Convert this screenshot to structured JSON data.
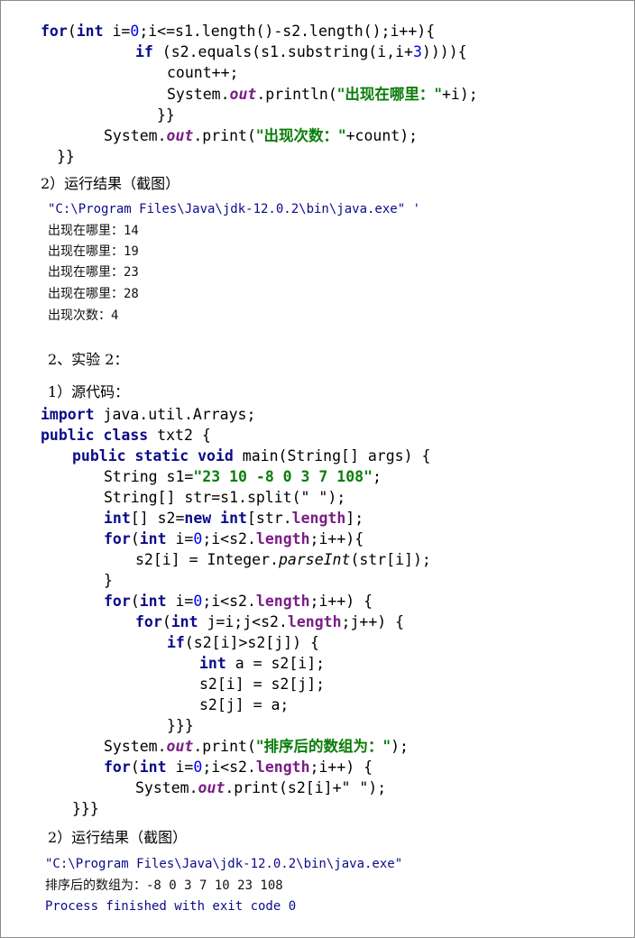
{
  "code1": {
    "line1": [
      "for",
      "(",
      "int",
      " i=",
      "0",
      ";i<=s1.length()-s2.length();i++){"
    ],
    "line2": [
      "if",
      " (s2.equals(s1.substring(i,i+",
      "3",
      ")))){"
    ],
    "line3": "count++;",
    "line4": [
      "System.",
      "out",
      ".println(",
      "\"出现在哪里：\"",
      "+i);"
    ],
    "line5": "}}",
    "line6": [
      "System.",
      "out",
      ".print(",
      "\"出现次数：\"",
      "+count);"
    ],
    "line7": "}}"
  },
  "section1_result": "2）运行结果（截图）",
  "output1": {
    "path": "\"C:\\Program Files\\Java\\jdk-12.0.2\\bin\\java.exe\" '",
    "lines": [
      {
        "label": "出现在哪里：",
        "value": "14"
      },
      {
        "label": "出现在哪里：",
        "value": "19"
      },
      {
        "label": "出现在哪里：",
        "value": "23"
      },
      {
        "label": "出现在哪里：",
        "value": "28"
      },
      {
        "label": "出现次数：",
        "value": "4"
      }
    ]
  },
  "experiment2": "2、实验 2：",
  "source_label": "1）源代码：",
  "code2": {
    "import": [
      "import",
      " java.util.Arrays;"
    ],
    "class": [
      "public",
      " ",
      "class",
      " txt2 {"
    ],
    "main": [
      "public",
      " ",
      "static",
      " ",
      "void",
      " main(String[] args) {"
    ],
    "s1": [
      "String s1=",
      "\"23 10 -8 0 3 7 108\"",
      ";"
    ],
    "split": "String[] str=s1.split(\" \");",
    "arr": [
      "int",
      "[] s2=",
      "new",
      " ",
      "int",
      "[str.",
      "length",
      "];"
    ],
    "for1": [
      "for",
      "(",
      "int",
      " i=",
      "0",
      ";i<s2.",
      "length",
      ";i++){"
    ],
    "parse": [
      "s2[i] = Integer.",
      "parseInt",
      "(str[i]);"
    ],
    "close1": "}",
    "for2": [
      "for",
      "(",
      "int",
      " i=",
      "0",
      ";i<s2.",
      "length",
      ";i++) {"
    ],
    "for3": [
      "for",
      "(",
      "int",
      " j=i;j<s2.",
      "length",
      ";j++) {"
    ],
    "if": [
      "if",
      "(s2[i]>s2[j]) {"
    ],
    "swap1": [
      "int",
      " a = s2[i];"
    ],
    "swap2": "s2[i] = s2[j];",
    "swap3": "s2[j] = a;",
    "close2": "}}}",
    "print1": [
      "System.",
      "out",
      ".print(",
      "\"排序后的数组为：\"",
      ");"
    ],
    "for4": [
      "for",
      "(",
      "int",
      " i=",
      "0",
      ";i<s2.",
      "length",
      ";i++) {"
    ],
    "print2": [
      "System.",
      "out",
      ".print(s2[i]+\" \");"
    ],
    "close3": "}}}"
  },
  "section2_result": "2）运行结果（截图）",
  "output2": {
    "path": "\"C:\\Program Files\\Java\\jdk-12.0.2\\bin\\java.exe\"",
    "label": "排序后的数组为：",
    "values": "-8 0 3 7 10 23 108",
    "exit": "Process finished with exit code 0"
  }
}
